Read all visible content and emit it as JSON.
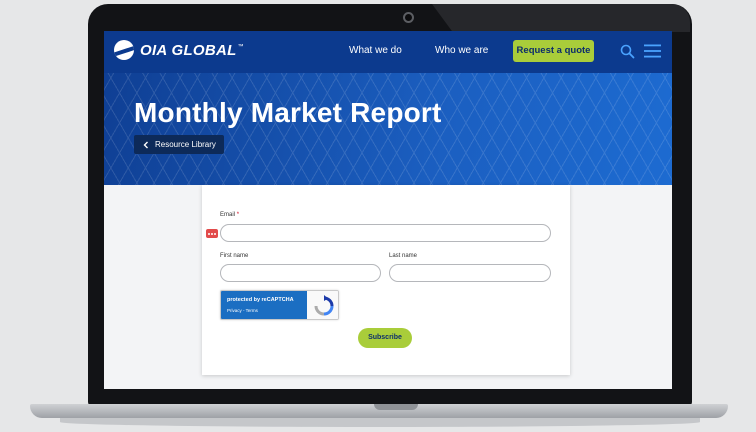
{
  "brand": {
    "name": "OIA GLOBAL",
    "trademark": "™"
  },
  "nav": {
    "links": [
      "What we do",
      "Who we are"
    ],
    "cta": "Request a quote"
  },
  "hero": {
    "title": "Monthly Market Report",
    "back_label": "Resource Library"
  },
  "form": {
    "email_label": "Email",
    "required_mark": "*",
    "first_name_label": "First name",
    "last_name_label": "Last name",
    "email_value": "",
    "first_name_value": "",
    "last_name_value": "",
    "captcha_text": "protected by reCAPTCHA",
    "captcha_links": "Privacy - Terms",
    "submit_label": "Subscribe"
  },
  "colors": {
    "nav": "#0c3a8e",
    "accent": "#a9cd3a",
    "hero": "#1b5fc1",
    "captcha": "#1b6ec2"
  }
}
